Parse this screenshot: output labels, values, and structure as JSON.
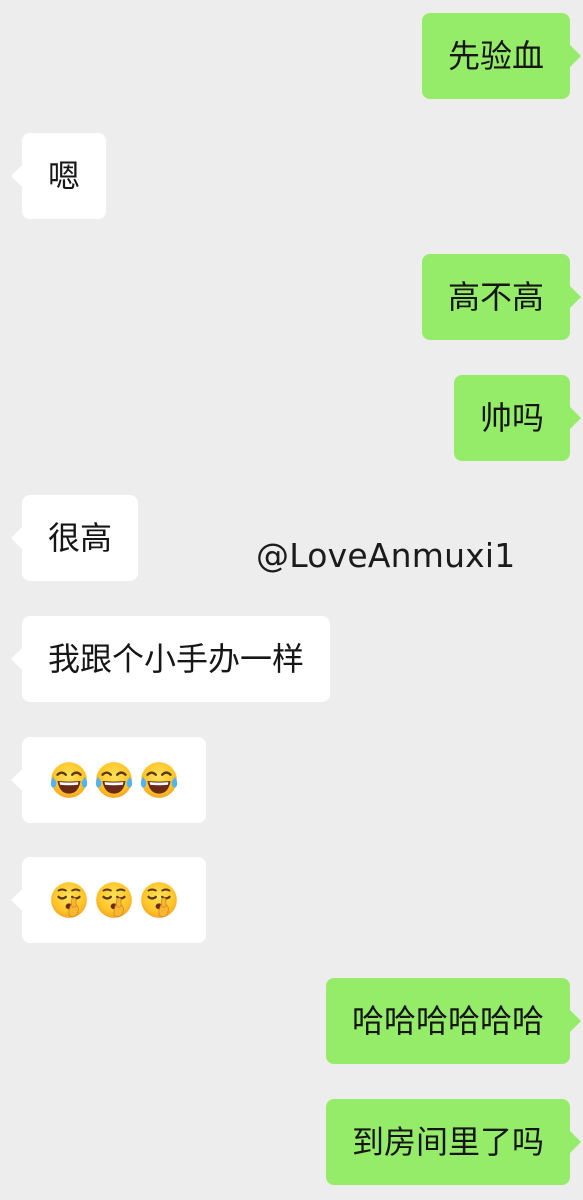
{
  "conversation": {
    "messages": [
      {
        "side": "out",
        "text": "先验血"
      },
      {
        "side": "in",
        "text": "嗯"
      },
      {
        "side": "out",
        "text": "高不高"
      },
      {
        "side": "out",
        "text": "帅吗"
      },
      {
        "side": "in",
        "text": "很高"
      },
      {
        "side": "in",
        "text": "我跟个小手办一样"
      },
      {
        "side": "in",
        "emoji": [
          "tears-of-joy-icon",
          "tears-of-joy-icon",
          "tears-of-joy-icon"
        ]
      },
      {
        "side": "in",
        "emoji": [
          "shushing-face-icon",
          "shushing-face-icon",
          "shushing-face-icon"
        ]
      },
      {
        "side": "out",
        "text": "哈哈哈哈哈哈"
      },
      {
        "side": "out",
        "text": "到房间里了吗"
      }
    ]
  },
  "watermark": "@LoveAnmuxi1",
  "colors": {
    "background": "#ededed",
    "incoming_bubble": "#ffffff",
    "outgoing_bubble": "#95ec69",
    "text": "#161616"
  }
}
